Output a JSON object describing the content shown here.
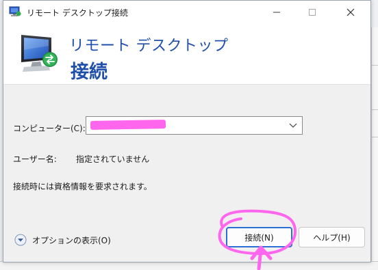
{
  "window": {
    "title": "リモート デスクトップ接続"
  },
  "header": {
    "title": "リモート デスクトップ",
    "subtitle": "接続"
  },
  "form": {
    "computer_label": "コンピューター(C):",
    "computer_value_redacted": true,
    "username_label": "ユーザー名:",
    "username_value": "指定されていません",
    "credential_note": "接続時には資格情報を要求されます。"
  },
  "footer": {
    "options_label": "オプションの表示(O)",
    "connect_label": "接続(N)",
    "help_label": "ヘルプ(H)"
  },
  "colors": {
    "accent": "#1f4fa8",
    "annotation": "#ff66ee",
    "focus": "#2c6fd4"
  }
}
